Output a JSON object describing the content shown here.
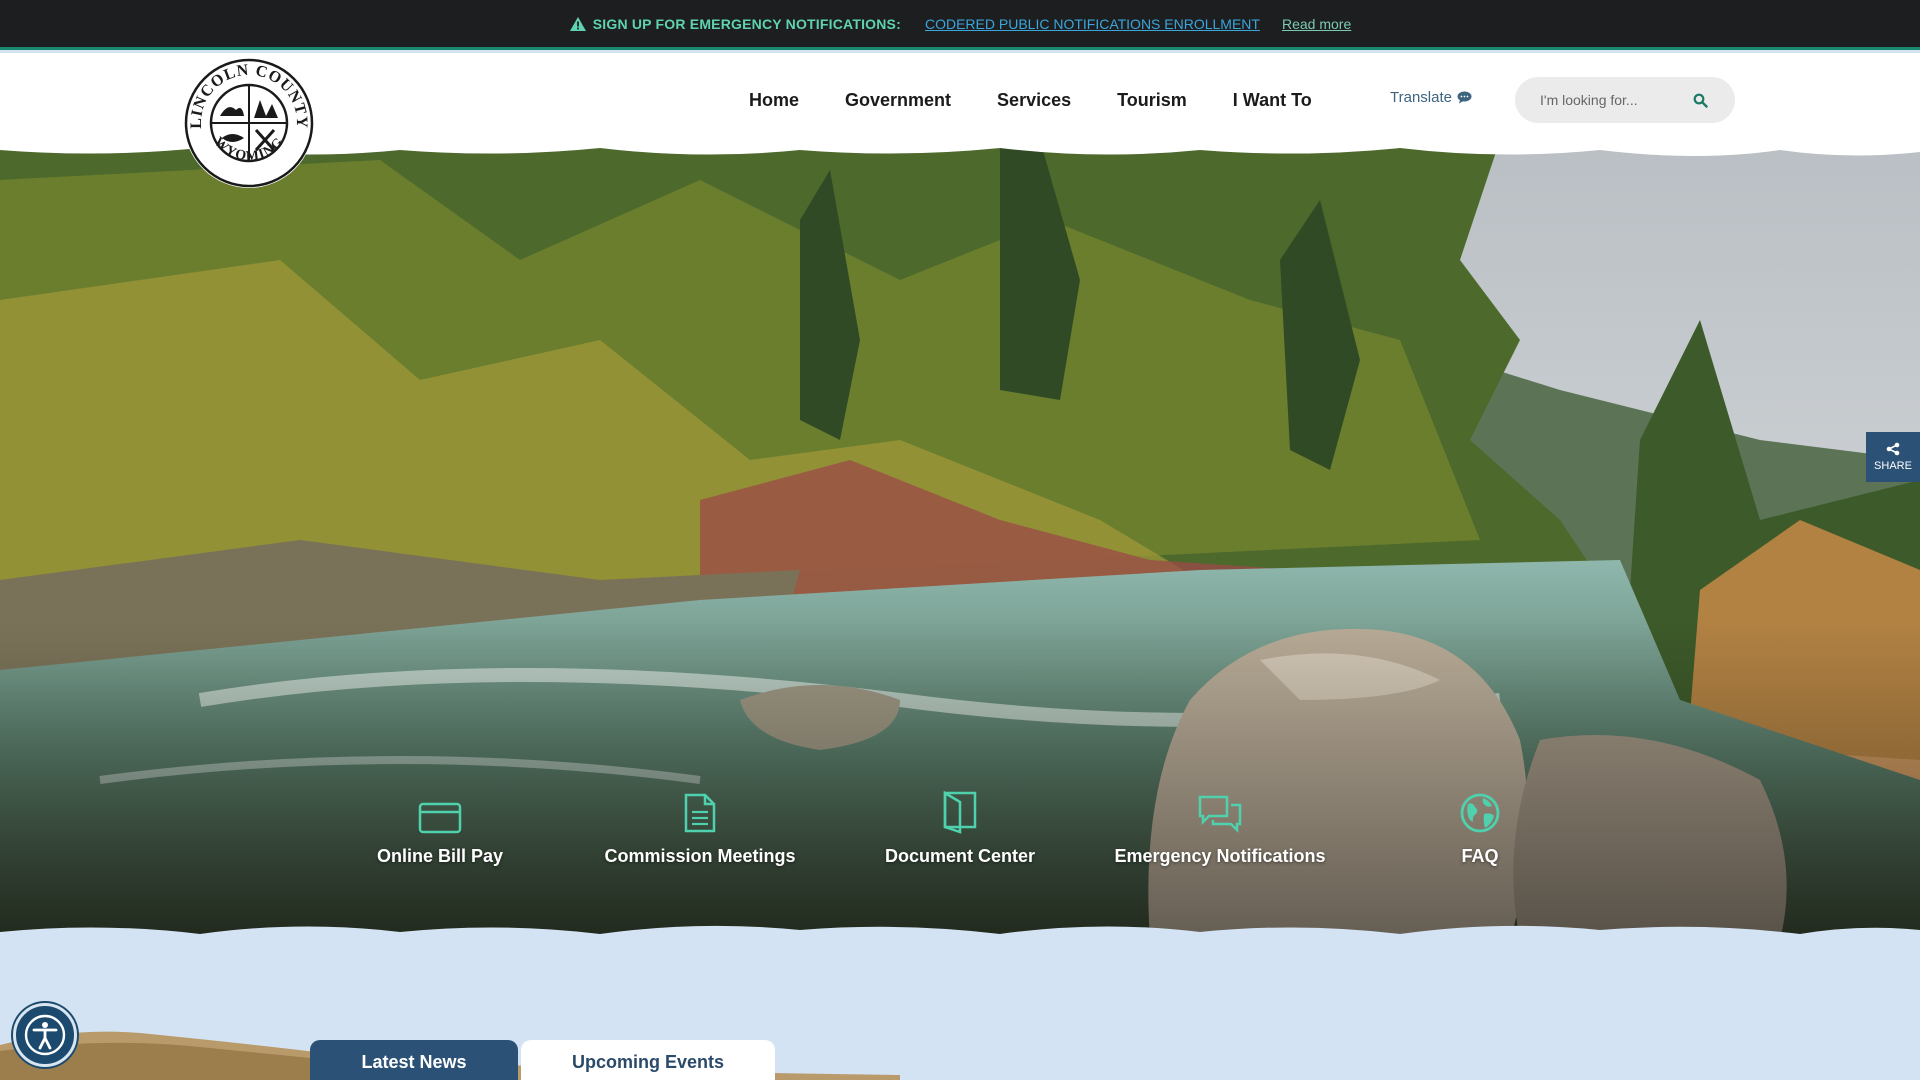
{
  "alert": {
    "label": "SIGN UP FOR  EMERGENCY NOTIFICATIONS:",
    "link": "CODERED PUBLIC NOTIFICATIONS ENROLLMENT",
    "more": "Read more",
    "icon": "warning-icon"
  },
  "logo": {
    "top_text": "LINCOLN COUNTY",
    "bottom_text": "WYOMING"
  },
  "nav": {
    "items": [
      {
        "label": "Home"
      },
      {
        "label": "Government"
      },
      {
        "label": "Services"
      },
      {
        "label": "Tourism"
      },
      {
        "label": "I Want To"
      }
    ]
  },
  "translate": {
    "label": "Translate",
    "icon": "speech-bubble-icon"
  },
  "search": {
    "placeholder": "I'm looking for...",
    "icon": "search-icon"
  },
  "share": {
    "label": "SHARE",
    "icon": "share-icon"
  },
  "quicklinks": [
    {
      "label": "Online Bill Pay",
      "icon": "credit-card-icon"
    },
    {
      "label": "Commission Meetings",
      "icon": "document-icon"
    },
    {
      "label": "Document Center",
      "icon": "open-book-icon"
    },
    {
      "label": "Emergency Notifications",
      "icon": "chat-bubbles-icon"
    },
    {
      "label": "FAQ",
      "icon": "globe-icon"
    }
  ],
  "tabs": [
    {
      "label": "Latest News",
      "active": true
    },
    {
      "label": "Upcoming Events",
      "active": false
    }
  ],
  "colors": {
    "accent_green": "#5fd3b1",
    "link_blue": "#3aa6dc",
    "nav_dark": "#2b5276",
    "page_bg": "#d4e3f3"
  }
}
